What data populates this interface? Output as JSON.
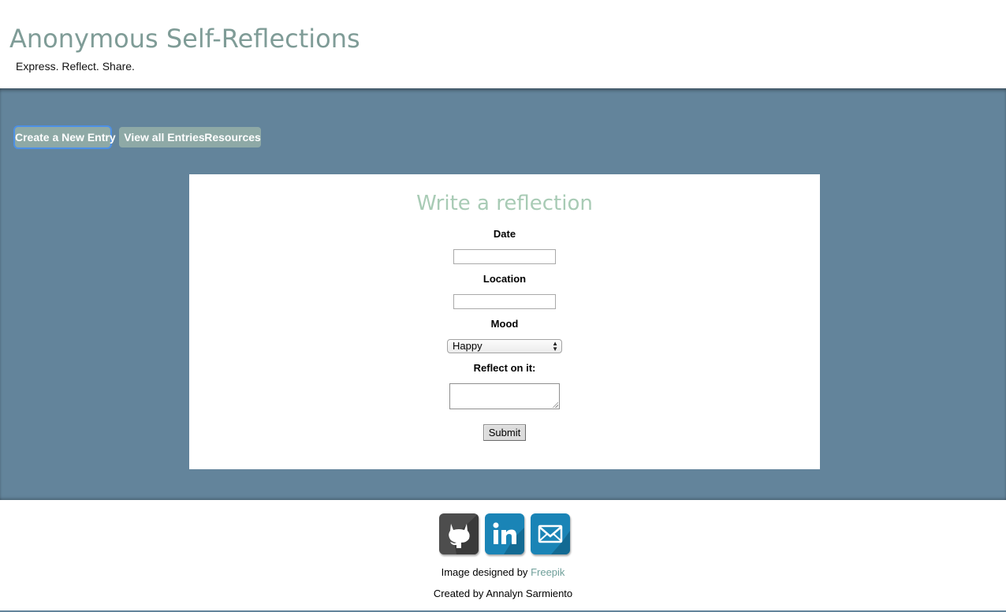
{
  "header": {
    "title": "Anonymous Self-Reflections",
    "tagline": "Express. Reflect. Share."
  },
  "nav": {
    "items": [
      {
        "label": "Create a New Entry",
        "active": true
      },
      {
        "label": "View all Entries",
        "active": false
      },
      {
        "label": "Resources",
        "active": false
      }
    ]
  },
  "form": {
    "title": "Write a reflection",
    "date_label": "Date",
    "date_value": "",
    "location_label": "Location",
    "location_value": "",
    "mood_label": "Mood",
    "mood_selected": "Happy",
    "reflect_label": "Reflect on it:",
    "reflect_value": "",
    "submit_label": "Submit"
  },
  "footer": {
    "social_icons": [
      "github-icon",
      "linkedin-icon",
      "email-icon"
    ],
    "image_credit_prefix": "Image designed by",
    "image_credit_link": "Freepik",
    "created_by": "Created by Annalyn Sarmiento"
  },
  "colors": {
    "band": "#63849b",
    "title": "#7f9c97",
    "nav_button": "#8ea9a6",
    "form_title": "#a8cbb5",
    "link": "#6f9f9a"
  }
}
